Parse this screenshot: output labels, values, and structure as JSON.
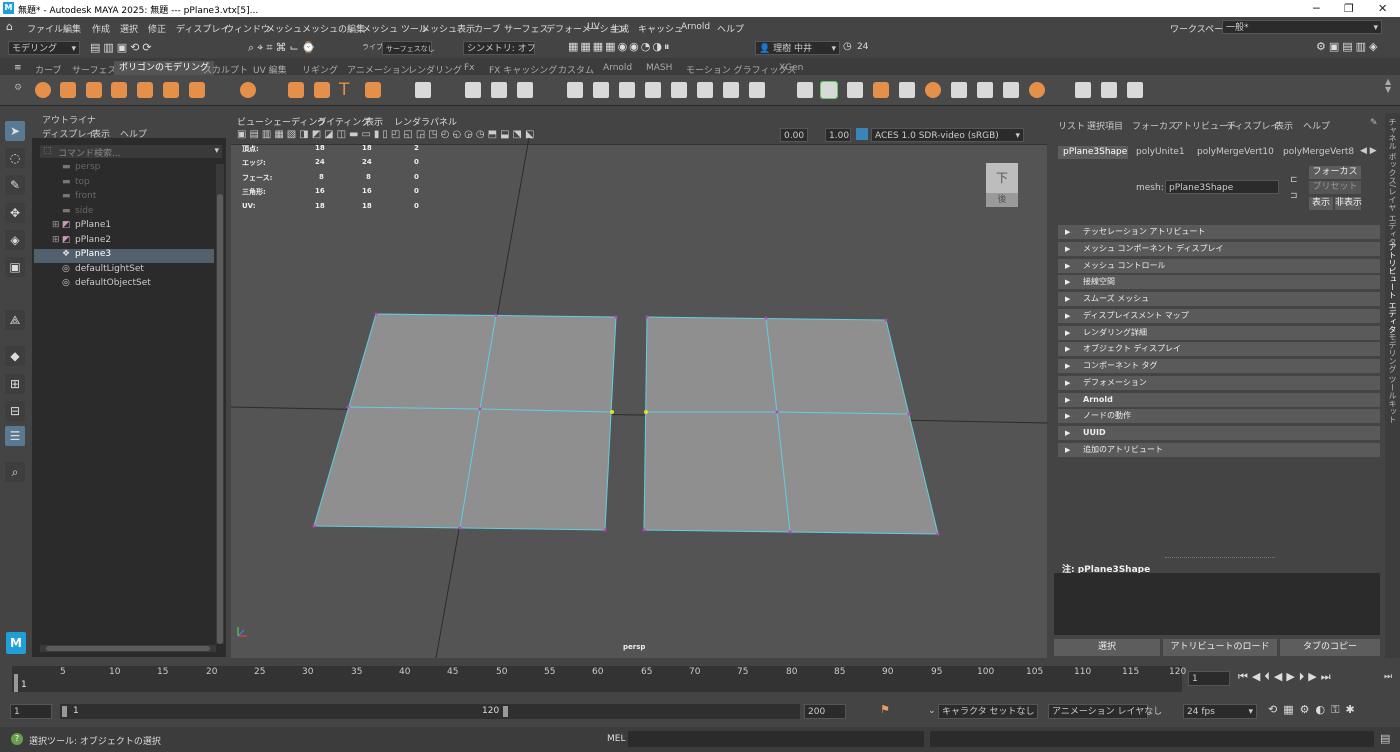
{
  "titlebar": {
    "title": "無題* - Autodesk MAYA 2025: 無題   ---   pPlane3.vtx[5]..."
  },
  "menubar": {
    "items": [
      "ファイル",
      "編集",
      "作成",
      "選択",
      "修正",
      "ディスプレイ",
      "ウィンドウ",
      "メッシュ",
      "メッシュの編集",
      "メッシュ ツール",
      "メッシュ表示",
      "カーブ",
      "サーフェス",
      "デフォーメーション",
      "UV",
      "生成",
      "キャッシュ",
      "Arnold",
      "ヘルプ"
    ],
    "workspace_label": "ワークスペース:",
    "workspace_value": "一般*"
  },
  "statusline": {
    "mode": "モデリング",
    "live": "ライブ",
    "live_value": "サーフェスなし",
    "symmetry": "シンメトリ: オフ",
    "user": "理樹 中井",
    "count": "24"
  },
  "shelf": {
    "tabs": [
      "カーブ",
      "サーフェス",
      "ポリゴンのモデリング",
      "スカルプト",
      "UV 編集",
      "リギング",
      "アニメーション",
      "レンダリング",
      "Fx",
      "FX キャッシング",
      "カスタム",
      "Arnold",
      "MASH",
      "モーション グラフィックス",
      "XGen"
    ],
    "active_tab": 2
  },
  "outliner": {
    "title": "アウトライナ",
    "menus": [
      "ディスプレイ",
      "表示",
      "ヘルプ"
    ],
    "search_placeholder": "コマンド検索...",
    "items": [
      {
        "label": "persp",
        "kind": "camera",
        "dim": true
      },
      {
        "label": "top",
        "kind": "camera",
        "dim": true
      },
      {
        "label": "front",
        "kind": "camera",
        "dim": true
      },
      {
        "label": "side",
        "kind": "camera",
        "dim": true
      },
      {
        "label": "pPlane1",
        "kind": "mesh",
        "dim": false
      },
      {
        "label": "pPlane2",
        "kind": "mesh",
        "dim": false
      },
      {
        "label": "pPlane3",
        "kind": "mesh",
        "dim": false,
        "selected": true
      },
      {
        "label": "defaultLightSet",
        "kind": "set",
        "dim": false
      },
      {
        "label": "defaultObjectSet",
        "kind": "set",
        "dim": false
      }
    ]
  },
  "viewport": {
    "menus": [
      "ビュー",
      "シェーディング",
      "ライティング",
      "表示",
      "レンダラ",
      "パネル"
    ],
    "field_a": "0.00",
    "field_b": "1.00",
    "colorspace": "ACES 1.0 SDR-video (sRGB)",
    "camera_label": "persp",
    "viewcube_top": "下",
    "viewcube_front": "後",
    "hud": [
      {
        "label": "頂点:",
        "c1": "18",
        "c2": "18",
        "c3": "2"
      },
      {
        "label": "エッジ:",
        "c1": "24",
        "c2": "24",
        "c3": "0"
      },
      {
        "label": "フェース:",
        "c1": "8",
        "c2": "8",
        "c3": "0"
      },
      {
        "label": "三角形:",
        "c1": "16",
        "c2": "16",
        "c3": "0"
      },
      {
        "label": "UV:",
        "c1": "18",
        "c2": "18",
        "c3": "0"
      }
    ]
  },
  "attr": {
    "menus": [
      "リスト",
      "選択項目",
      "フォーカス",
      "アトリビュート",
      "ディスプレイ",
      "表示",
      "ヘルプ"
    ],
    "tabs": [
      "pPlane3Shape",
      "polyUnite1",
      "polyMergeVert10",
      "polyMergeVert8"
    ],
    "mesh_label": "mesh:",
    "mesh_value": "pPlane3Shape",
    "focus": "フォーカス",
    "preset": "プリセット",
    "show": "表示",
    "hide": "非表示",
    "sections": [
      "テッセレーション アトリビュート",
      "メッシュ コンポーネント ディスプレイ",
      "メッシュ コントロール",
      "接線空間",
      "スムーズ メッシュ",
      "ディスプレイスメント マップ",
      "レンダリング詳細",
      "オブジェクト ディスプレイ",
      "コンポーネント タグ",
      "デフォメーション",
      "Arnold",
      "ノードの動作",
      "UUID",
      "追加のアトリビュート"
    ],
    "note": "注:  pPlane3Shape",
    "bottom_buttons": [
      "選択",
      "アトリビュートのロード",
      "タブのコピー"
    ]
  },
  "sidebar": {
    "tabs": [
      "チャネル ボックス/レイヤ エディタ",
      "アトリビュート エディタ",
      "モデリング ツールキット"
    ]
  },
  "timeline": {
    "ticks": [
      "5",
      "10",
      "15",
      "20",
      "25",
      "30",
      "35",
      "40",
      "45",
      "50",
      "55",
      "60",
      "65",
      "70",
      "75",
      "80",
      "85",
      "90",
      "95",
      "100",
      "105",
      "110",
      "115",
      "120"
    ],
    "start_marker": "1",
    "current_frame": "1"
  },
  "range": {
    "start": "1",
    "inner_start": "1",
    "inner_end": "120",
    "end": "200",
    "character_set": "キャラクタ セットなし",
    "anim_layer": "アニメーション レイヤなし",
    "fps": "24 fps"
  },
  "cmd": {
    "help": "選択ツール: オブジェクトの選択",
    "lang": "MEL"
  },
  "colors": {
    "wire": "#5ed0e0",
    "vertex": "#c040c0",
    "selected_vertex": "#e0e030",
    "surface": "#8f8f8f"
  }
}
